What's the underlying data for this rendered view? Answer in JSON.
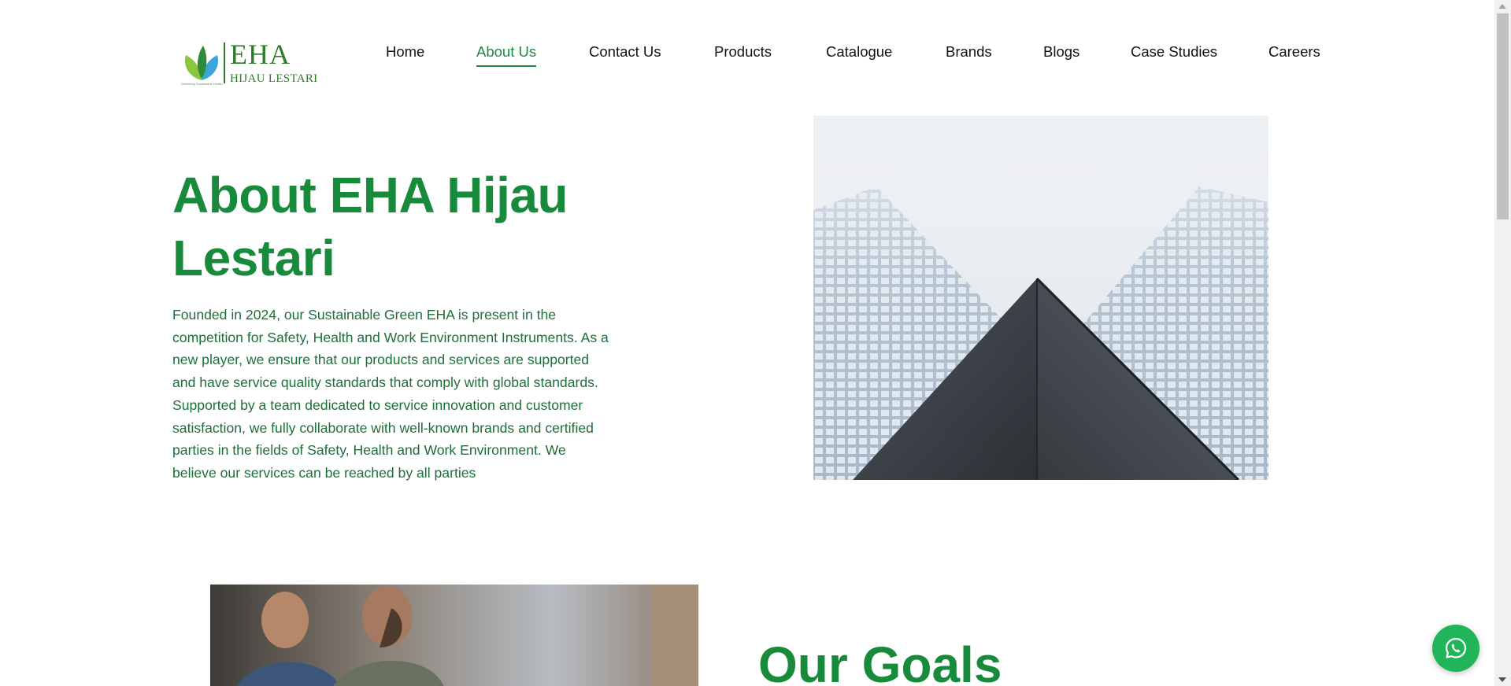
{
  "brand": {
    "name": "EHA",
    "subname": "HIJAU LESTARI",
    "tagline": "Delivering Sustainable Health"
  },
  "nav": {
    "items": [
      {
        "label": "Home"
      },
      {
        "label": "About Us",
        "active": true
      },
      {
        "label": "Contact Us"
      },
      {
        "label": "Products"
      },
      {
        "label": "Catalogue"
      },
      {
        "label": "Brands"
      },
      {
        "label": "Blogs"
      },
      {
        "label": "Case Studies"
      },
      {
        "label": "Careers"
      }
    ]
  },
  "hero": {
    "title": "About EHA Hijau Lestari",
    "description": "Founded in 2024, our Sustainable Green EHA is present in the competition for Safety, Health and Work Environment Instruments. As a new player, we ensure that our products and services are supported and have service quality standards that comply with global standards. Supported by a team dedicated to service innovation and customer satisfaction, we fully collaborate with well-known brands and certified parties in the fields of Safety, Health and Work Environment. We believe our services can be reached by all parties"
  },
  "goals": {
    "title": "Our Goals"
  },
  "icons": {
    "whatsapp": "whatsapp-icon"
  },
  "colors": {
    "primary_green": "#188a3c",
    "text_green": "#1e6e3a",
    "whatsapp_green": "#21b55a"
  }
}
